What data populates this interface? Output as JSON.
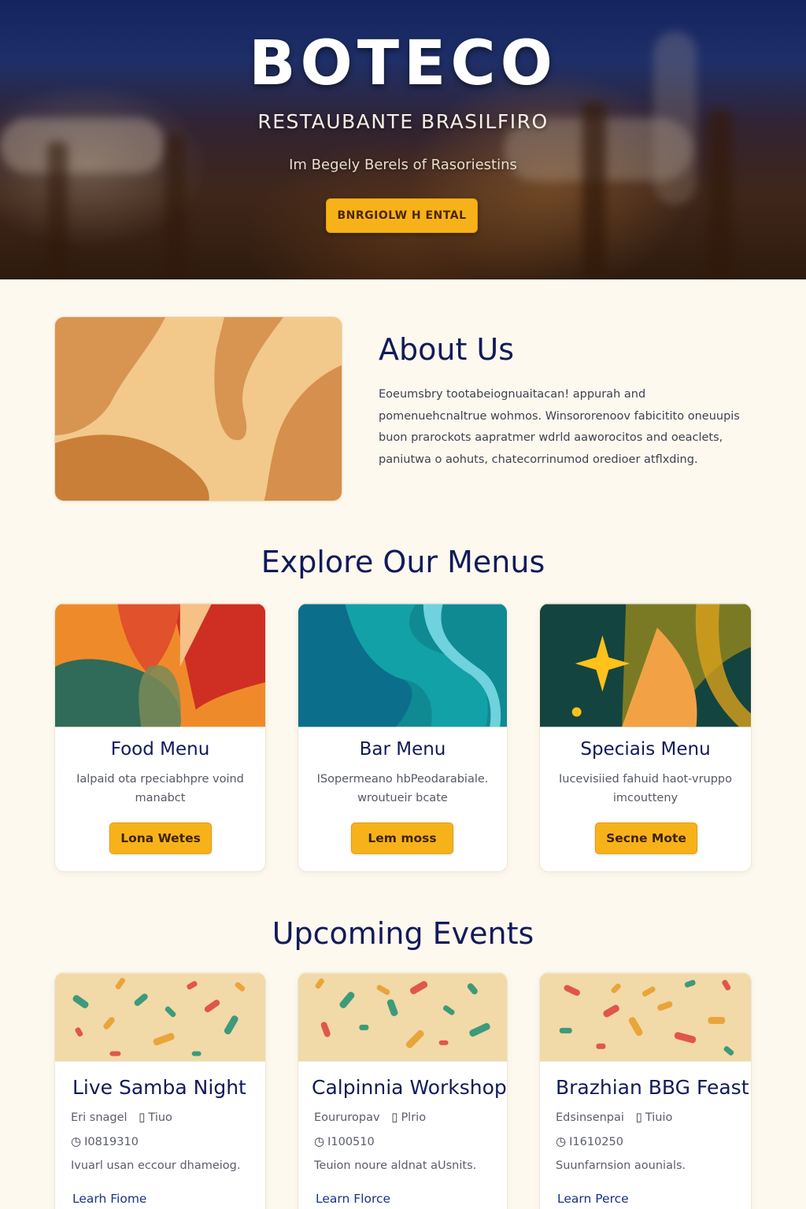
{
  "hero": {
    "title": "BOTECO",
    "subtitle": "RESTAUBANTE BRASILFIRO",
    "tagline": "Im Begely Berels of Rasoriestins",
    "cta_label": "BNRGIOLW H ENTAL"
  },
  "about": {
    "title": "About Us",
    "body": "Eoeumsbry tootabeiognuaitacan! appurah and pomenuehcnaltrue wohmos. Winsororenoov fabicitito oneuupis buon prarockots aapratmer wdrld aaworocitos and oeaclets, paniutwa o aohuts, chatecorrinumod oredioer atflxding."
  },
  "menus": {
    "title": "Explore Our Menus",
    "cards": [
      {
        "title": "Food Menu",
        "desc": "Ialpaid ota rpeciabhpre voind manabct",
        "button": "Lona Wetes"
      },
      {
        "title": "Bar Menu",
        "desc": "ISopermeano hbPeodarabiale. wroutueir bcate",
        "button": "Lem moss"
      },
      {
        "title": "Speciais Menu",
        "desc": "Iucevisiied fahuid haot-vruppo imcoutteny",
        "button": "Secne Mote"
      }
    ]
  },
  "events": {
    "title": "Upcoming Events",
    "items": [
      {
        "title": "Live Samba Night",
        "date": "Eri snagel",
        "time": "Tiuo",
        "time_id": "I0819310",
        "desc": "Ivuarl usan eccour dhameiog.",
        "link": "Learh Fiome"
      },
      {
        "title": "Calpinnia Workshop",
        "date": "Eoururopav",
        "time": "Plrio",
        "time_id": "I100510",
        "desc": "Teuion noure aldnat aUsnits.",
        "link": "Learn Florce"
      },
      {
        "title": "Brazhian BBG Feast",
        "date": "Edsinsenpai",
        "time": "Tiuio",
        "time_id": "I1610250",
        "desc": "Suunfarnsion aounials.",
        "link": "Learn Perce"
      }
    ]
  },
  "icons": {
    "calendar": "calendar-icon",
    "clock": "clock-icon"
  },
  "colors": {
    "accent": "#f7b21a",
    "heading": "#121a5a",
    "page_bg": "#fdf9ef"
  }
}
